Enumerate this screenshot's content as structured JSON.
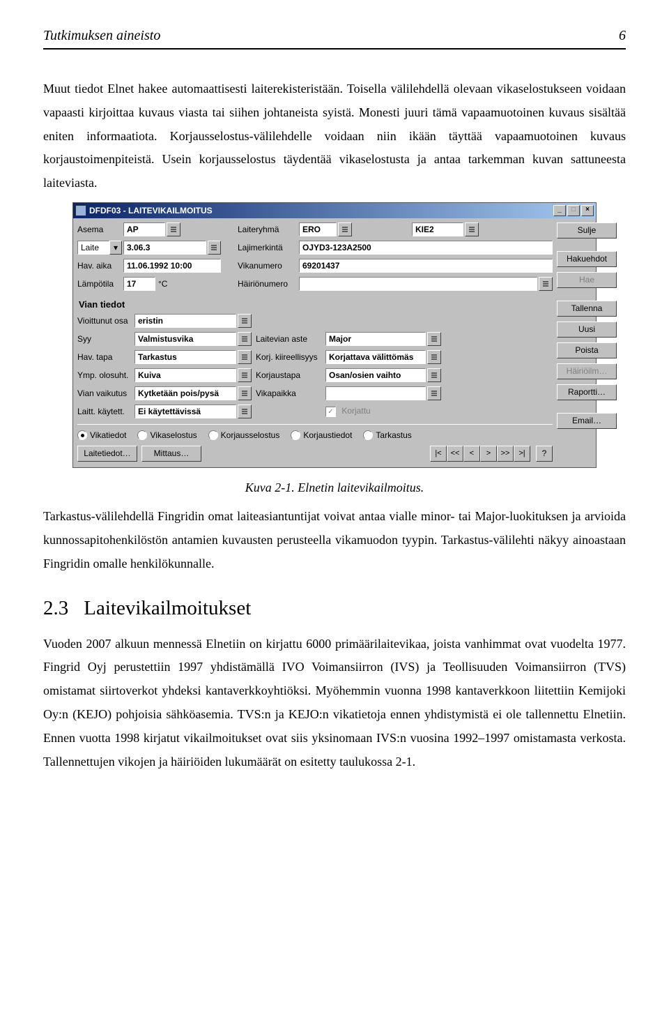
{
  "header": {
    "left": "Tutkimuksen aineisto",
    "page": "6"
  },
  "para1": "Muut tiedot Elnet hakee automaattisesti laiterekisteristään. Toisella välilehdellä olevaan vikaselostukseen voidaan vapaasti kirjoittaa kuvaus viasta tai siihen johtaneista syistä. Monesti juuri tämä vapaamuotoinen kuvaus sisältää eniten informaatiota. Korjausselostus-välilehdelle voidaan niin ikään täyttää vapaamuotoinen kuvaus korjaustoimenpiteistä. Usein korjausselostus täydentää vikaselostusta ja antaa tarkemman kuvan sattuneesta laiteviasta.",
  "caption": "Kuva 2-1. Elnetin laitevikailmoitus.",
  "para2": "Tarkastus-välilehdellä Fingridin omat laiteasiantuntijat voivat antaa vialle minor- tai Major-luokituksen ja arvioida kunnossapitohenkilöstön antamien kuvausten perusteella vikamuodon tyypin. Tarkastus-välilehti näkyy ainoastaan Fingridin omalle henkilökunnalle.",
  "section": {
    "num": "2.3",
    "title": "Laitevikailmoitukset"
  },
  "para3": "Vuoden 2007 alkuun mennessä Elnetiin on kirjattu 6000 primäärilaitevikaa, joista vanhimmat ovat vuodelta 1977. Fingrid Oyj perustettiin 1997 yhdistämällä IVO Voimansiirron (IVS) ja Teollisuuden Voimansiirron (TVS) omistamat siirtoverkot yhdeksi kantaverkkoyhtiöksi. Myöhemmin vuonna 1998 kantaverkkoon liitettiin Kemijoki Oy:n (KEJO) pohjoisia sähköasemia. TVS:n ja KEJO:n vikatietoja ennen yhdistymistä ei ole tallennettu Elnetiin. Ennen vuotta 1998 kirjatut vikailmoitukset ovat siis yksinomaan IVS:n vuosina 1992–1997 omistamasta verkosta. Tallennettujen vikojen ja häiriöiden lukumäärät on esitetty taulukossa 2-1.",
  "dlg": {
    "title": "DFDF03 - LAITEVIKAILMOITUS",
    "labels": {
      "asema": "Asema",
      "laiteryhma": "Laiteryhmä",
      "laite": "Laite",
      "lajimerkinta": "Lajimerkintä",
      "havaika": "Hav. aika",
      "vikanumero": "Vikanumero",
      "lampotila": "Lämpötila",
      "hairionumero": "Häiriönumero",
      "celsius": "°C",
      "viantiedot": "Vian tiedot",
      "vioittunut": "Vioittunut osa",
      "syy": "Syy",
      "havtapa": "Hav. tapa",
      "korjkiir": "Korj. kiireellisyys",
      "ympolo": "Ymp. olosuht.",
      "korjaustapa": "Korjaustapa",
      "vianvaik": "Vian vaikutus",
      "vikapaikka": "Vikapaikka",
      "laittkayt": "Laitt. käytett.",
      "laitevian": "Laitevian aste",
      "korjattu": "Korjattu"
    },
    "values": {
      "asema": "AP",
      "laiteryhma1": "ERO",
      "laiteryhma2": "KIE2",
      "laite": "3.06.3",
      "lajimerkinta": "OJYD3-123A2500",
      "havaika": "11.06.1992 10:00",
      "vikanumero": "69201437",
      "lampotila": "17",
      "hairionumero": "",
      "vioittunut": "eristin",
      "syy": "Valmistusvika",
      "havtapa": "Tarkastus",
      "ympolo": "Kuiva",
      "vianvaik": "Kytketään pois/pysä",
      "laittkayt": "Ei käytettävissä",
      "laitevian": "Major",
      "korjkiir": "Korjattava välittömäs",
      "korjaustapa": "Osan/osien vaihto",
      "vikapaikka": ""
    },
    "buttons": {
      "sulje": "Sulje",
      "hakuehdot": "Hakuehdot",
      "hae": "Hae",
      "tallenna": "Tallenna",
      "uusi": "Uusi",
      "poista": "Poista",
      "hairiilm": "Häiriöilm…",
      "raportti": "Raportti…",
      "email": "Email…",
      "laitetiedot": "Laitetiedot…",
      "mittaus": "Mittaus…",
      "help": "?"
    },
    "radios": {
      "vikatiedot": "Vikatiedot",
      "vikaselostus": "Vikaselostus",
      "korjausselostus": "Korjausselostus",
      "korjaustiedot": "Korjaustiedot",
      "tarkastus": "Tarkastus"
    },
    "nav": [
      "|<",
      "<<",
      "<",
      ">",
      ">>",
      ">|"
    ]
  }
}
